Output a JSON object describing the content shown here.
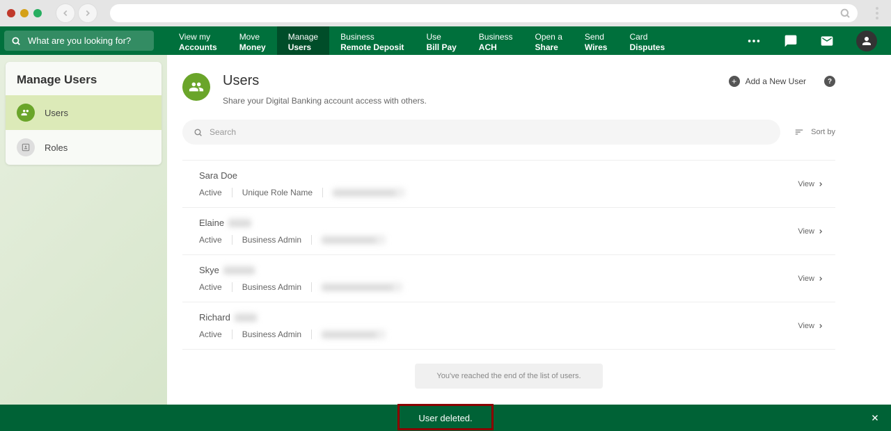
{
  "globalSearch": {
    "placeholder": "What are you looking for?"
  },
  "nav": [
    {
      "line1": "View my",
      "line2": "Accounts",
      "active": false
    },
    {
      "line1": "Move",
      "line2": "Money",
      "active": false
    },
    {
      "line1": "Manage",
      "line2": "Users",
      "active": true
    },
    {
      "line1": "Business",
      "line2": "Remote Deposit",
      "active": false
    },
    {
      "line1": "Use",
      "line2": "Bill Pay",
      "active": false
    },
    {
      "line1": "Business",
      "line2": "ACH",
      "active": false
    },
    {
      "line1": "Open a",
      "line2": "Share",
      "active": false
    },
    {
      "line1": "Send",
      "line2": "Wires",
      "active": false
    },
    {
      "line1": "Card",
      "line2": "Disputes",
      "active": false
    }
  ],
  "sidebar": {
    "title": "Manage Users",
    "items": [
      {
        "label": "Users",
        "active": true,
        "icon": "people"
      },
      {
        "label": "Roles",
        "active": false,
        "icon": "role"
      }
    ]
  },
  "page": {
    "title": "Users",
    "subtitle": "Share your Digital Banking account access with others.",
    "addLabel": "Add a New User",
    "searchPlaceholder": "Search",
    "sortLabel": "Sort by",
    "viewLabel": "View",
    "endMessage": "You've reached the end of the list of users."
  },
  "users": [
    {
      "name": "Sara Doe",
      "nameRedacted": "",
      "status": "Active",
      "role": "Unique Role Name",
      "emailRedacted": "xxxxxxxxxxxxxxx"
    },
    {
      "name": "Elaine",
      "nameRedacted": "xxxxx",
      "status": "Active",
      "role": "Business Admin",
      "emailRedacted": "xxxxxxxxxxxxx"
    },
    {
      "name": "Skye",
      "nameRedacted": "xxxxxxx",
      "status": "Active",
      "role": "Business Admin",
      "emailRedacted": "xxxxxxxxxxxxxxxxx"
    },
    {
      "name": "Richard",
      "nameRedacted": "xxxxx",
      "status": "Active",
      "role": "Business Admin",
      "emailRedacted": "xxxxxxxxxxxxx"
    }
  ],
  "toast": {
    "message": "User deleted."
  }
}
